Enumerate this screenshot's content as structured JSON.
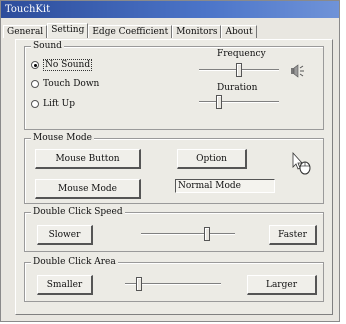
{
  "window": {
    "title": "TouchKit"
  },
  "tabs": [
    "General",
    "Setting",
    "Edge Coefficient",
    "Monitors",
    "About"
  ],
  "active_tab": "Setting",
  "sound": {
    "title": "Sound",
    "options": [
      "No Sound",
      "Touch Down",
      "Lift Up"
    ],
    "selected": "No Sound",
    "frequency_label": "Frequency",
    "frequency_level": 0.5,
    "duration_label": "Duration",
    "duration_level": 0.25,
    "icon": "speaker-icon"
  },
  "mouse_mode": {
    "title": "Mouse Mode",
    "mouse_button_label": "Mouse Button",
    "option_label": "Option",
    "mouse_mode_label": "Mouse Mode",
    "current_mode": "Normal Mode",
    "icon": "mouse-icon"
  },
  "double_click_speed": {
    "title": "Double Click Speed",
    "slower_label": "Slower",
    "faster_label": "Faster",
    "level": 0.7
  },
  "double_click_area": {
    "title": "Double Click Area",
    "smaller_label": "Smaller",
    "larger_label": "Larger",
    "level": 0.15
  }
}
